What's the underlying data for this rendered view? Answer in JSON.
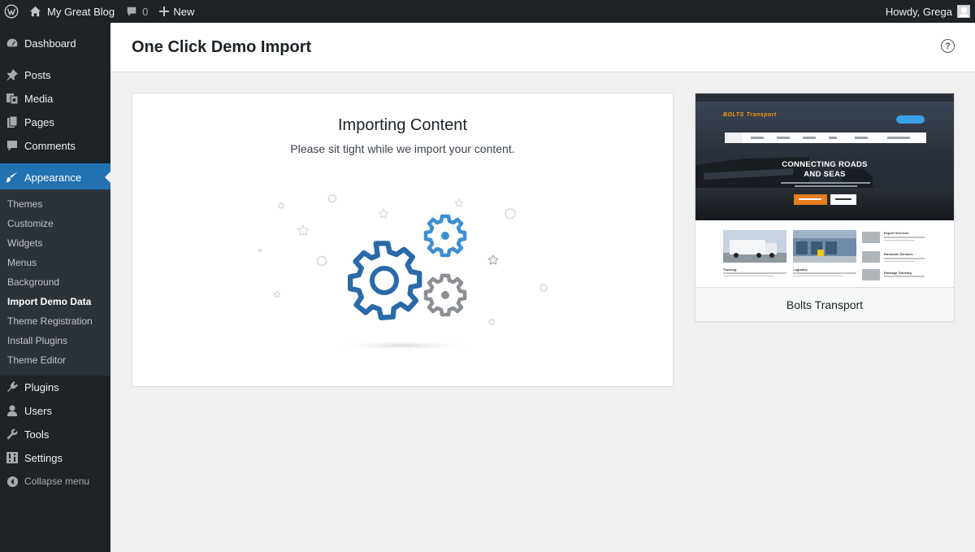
{
  "admin_bar": {
    "site_name": "My Great Blog",
    "comments_count": "0",
    "new_label": "New",
    "greeting": "Howdy, Grega"
  },
  "sidebar": {
    "items": [
      {
        "label": "Dashboard",
        "icon": "dashboard-icon"
      },
      {
        "label": "Posts",
        "icon": "pin-icon"
      },
      {
        "label": "Media",
        "icon": "media-icon"
      },
      {
        "label": "Pages",
        "icon": "pages-icon"
      },
      {
        "label": "Comments",
        "icon": "comment-icon"
      },
      {
        "label": "Appearance",
        "icon": "paintbrush-icon"
      },
      {
        "label": "Plugins",
        "icon": "plugin-icon"
      },
      {
        "label": "Users",
        "icon": "user-icon"
      },
      {
        "label": "Tools",
        "icon": "wrench-icon"
      },
      {
        "label": "Settings",
        "icon": "settings-icon"
      }
    ],
    "submenu": [
      "Themes",
      "Customize",
      "Widgets",
      "Menus",
      "Background",
      "Import Demo Data",
      "Theme Registration",
      "Install Plugins",
      "Theme Editor"
    ],
    "collapse_label": "Collapse menu",
    "current_item": "Appearance",
    "current_subitem": "Import Demo Data"
  },
  "page": {
    "title": "One Click Demo Import",
    "help_icon": "help-circle-icon"
  },
  "import": {
    "title": "Importing Content",
    "subtitle": "Please sit tight while we import your content."
  },
  "demo": {
    "name": "Bolts Transport",
    "screenshot": {
      "logo": "BOLTS",
      "logo_tag": "Transport",
      "headline_1": "CONNECTING ROADS",
      "headline_2": "AND SEAS",
      "captions": [
        "Tracking",
        "Logistics"
      ],
      "services": [
        "Export Services",
        "Domestic Services",
        "Package Tracking"
      ]
    }
  },
  "colors": {
    "admin_dark": "#1d2327",
    "submenu_bg": "#2c3338",
    "accent": "#2271b1",
    "gear_blue_dark": "#2b6aa8",
    "gear_blue_light": "#3d8fd1",
    "gear_grey": "#8c8f94"
  }
}
